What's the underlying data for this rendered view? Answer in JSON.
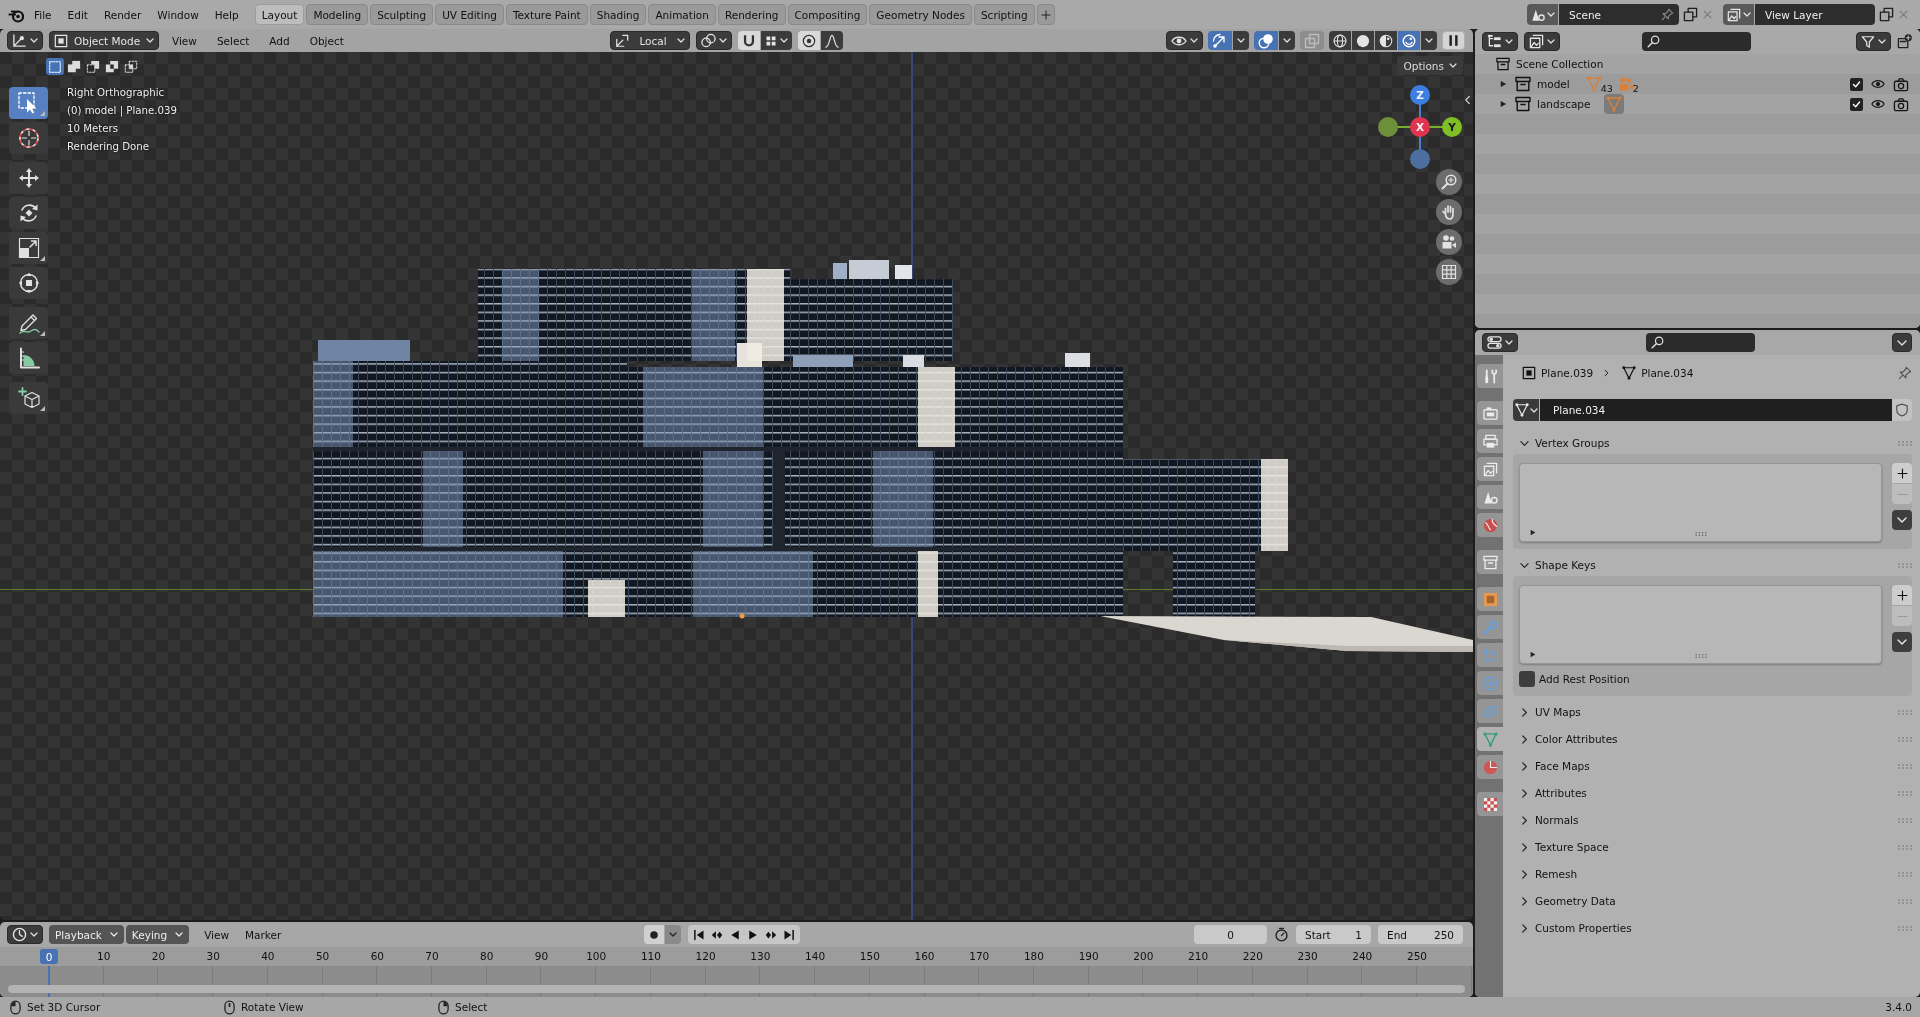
{
  "top_bar": {
    "menus": [
      "File",
      "Edit",
      "Render",
      "Window",
      "Help"
    ],
    "workspaces": [
      {
        "label": "Layout",
        "selected": true
      },
      {
        "label": "Modeling",
        "selected": false
      },
      {
        "label": "Sculpting",
        "selected": false
      },
      {
        "label": "UV Editing",
        "selected": false
      },
      {
        "label": "Texture Paint",
        "selected": false
      },
      {
        "label": "Shading",
        "selected": false
      },
      {
        "label": "Animation",
        "selected": false
      },
      {
        "label": "Rendering",
        "selected": false
      },
      {
        "label": "Compositing",
        "selected": false
      },
      {
        "label": "Geometry Nodes",
        "selected": false
      },
      {
        "label": "Scripting",
        "selected": false
      }
    ],
    "scene": "Scene",
    "view_layer": "View Layer"
  },
  "viewport": {
    "mode": "Object Mode",
    "menus": [
      "View",
      "Select",
      "Add",
      "Object"
    ],
    "orientation": "Local",
    "overlay_toggles": [
      {
        "kind": "gizmos",
        "on": true
      },
      {
        "kind": "overlays",
        "on": true
      },
      {
        "kind": "xray",
        "on": false
      }
    ],
    "shading": [
      {
        "kind": "wireframe",
        "selected": false
      },
      {
        "kind": "solid",
        "selected": false
      },
      {
        "kind": "material",
        "selected": false
      },
      {
        "kind": "rendered",
        "selected": true
      }
    ],
    "select_modes": [
      {
        "kind": "new",
        "selected": true
      },
      {
        "kind": "extend",
        "selected": false
      },
      {
        "kind": "subtract",
        "selected": false
      },
      {
        "kind": "difference",
        "selected": false
      },
      {
        "kind": "intersect",
        "selected": false
      }
    ],
    "options": "Options",
    "info": [
      "Right Orthographic",
      "(0) model | Plane.039",
      "10 Meters",
      "Rendering Done"
    ],
    "tool_groups": [
      [
        {
          "kind": "select_box",
          "selected": true,
          "variants": true
        },
        {
          "kind": "cursor",
          "selected": false,
          "variants": false
        }
      ],
      [
        {
          "kind": "move",
          "selected": false,
          "variants": false
        },
        {
          "kind": "rotate",
          "selected": false,
          "variants": false
        },
        {
          "kind": "scale",
          "selected": false,
          "variants": true
        },
        {
          "kind": "transform",
          "selected": false,
          "variants": false
        }
      ],
      [
        {
          "kind": "annotate",
          "selected": false,
          "variants": true
        },
        {
          "kind": "measure",
          "selected": false,
          "variants": false
        }
      ],
      [
        {
          "kind": "add_cube",
          "selected": false,
          "variants": true
        }
      ]
    ],
    "axes": [
      {
        "kind": "z",
        "label": "Z"
      },
      {
        "kind": "x",
        "label": "X"
      },
      {
        "kind": "y",
        "label": "Y"
      }
    ]
  },
  "outliner": {
    "tree": [
      {
        "name": "Scene Collection",
        "children": [
          {
            "name": "model",
            "expanded": false,
            "checked": true,
            "contents": [
              {
                "kind": "mesh",
                "count": "43",
                "active": false
              },
              {
                "kind": "camera",
                "count": "2",
                "active": false
              }
            ]
          },
          {
            "name": "landscape",
            "expanded": false,
            "checked": true,
            "contents": [
              {
                "kind": "mesh",
                "active": true
              }
            ]
          }
        ]
      }
    ]
  },
  "properties": {
    "tab_groups": [
      [
        {
          "kind": "tool",
          "selected": false
        }
      ],
      [
        {
          "kind": "render",
          "selected": false
        },
        {
          "kind": "output",
          "selected": false
        },
        {
          "kind": "view_layer",
          "selected": false
        },
        {
          "kind": "scene",
          "selected": false
        },
        {
          "kind": "world",
          "selected": false
        }
      ],
      [
        {
          "kind": "collection",
          "selected": false
        }
      ],
      [
        {
          "kind": "object",
          "selected": false
        },
        {
          "kind": "modifiers",
          "selected": false
        },
        {
          "kind": "particles",
          "selected": false
        },
        {
          "kind": "physics",
          "selected": false
        },
        {
          "kind": "constraints",
          "selected": false
        },
        {
          "kind": "data",
          "selected": true
        },
        {
          "kind": "material",
          "selected": false
        }
      ],
      [
        {
          "kind": "texture",
          "selected": false
        }
      ]
    ],
    "path": [
      {
        "kind": "object",
        "label": "Plane.039"
      },
      {
        "kind": "mesh",
        "label": "Plane.034"
      }
    ],
    "datablock": "Plane.034",
    "panels": [
      {
        "title": "Vertex Groups",
        "expanded": true
      },
      {
        "title": "Shape Keys",
        "expanded": true,
        "option": {
          "label": "Add Rest Position",
          "checked": false
        }
      },
      {
        "title": "UV Maps",
        "expanded": false
      },
      {
        "title": "Color Attributes",
        "expanded": false
      },
      {
        "title": "Face Maps",
        "expanded": false
      },
      {
        "title": "Attributes",
        "expanded": false
      },
      {
        "title": "Normals",
        "expanded": false
      },
      {
        "title": "Texture Space",
        "expanded": false
      },
      {
        "title": "Remesh",
        "expanded": false
      },
      {
        "title": "Geometry Data",
        "expanded": false
      },
      {
        "title": "Custom Properties",
        "expanded": false
      }
    ]
  },
  "timeline": {
    "menus": [
      {
        "kind": "dropdown",
        "label": "Playback"
      },
      {
        "kind": "dropdown",
        "label": "Keying"
      },
      {
        "kind": "plain",
        "label": "View"
      },
      {
        "kind": "plain",
        "label": "Marker"
      }
    ],
    "current_frame": "0",
    "start": {
      "label": "Start",
      "value": "1"
    },
    "end": {
      "label": "End",
      "value": "250"
    },
    "playhead": "0",
    "ruler": [
      "10",
      "20",
      "30",
      "40",
      "50",
      "60",
      "70",
      "80",
      "90",
      "100",
      "110",
      "120",
      "130",
      "140",
      "150",
      "160",
      "170",
      "180",
      "190",
      "200",
      "210",
      "220",
      "230",
      "240",
      "250"
    ]
  },
  "status_bar": {
    "hints": [
      {
        "kind": "left",
        "label": "Set 3D Cursor"
      },
      {
        "kind": "middle",
        "label": "Rotate View"
      },
      {
        "kind": "right",
        "label": "Select"
      }
    ],
    "version": "3.4.0"
  }
}
